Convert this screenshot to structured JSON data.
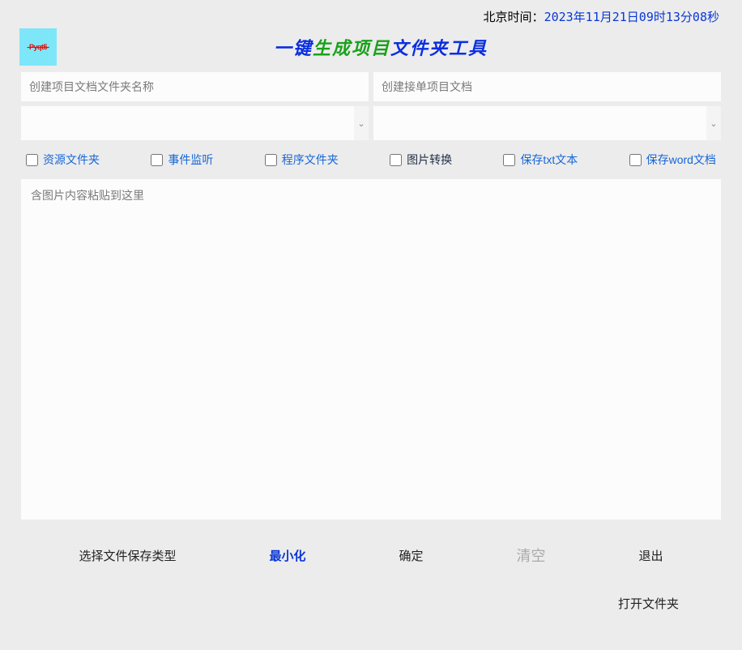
{
  "header": {
    "time_label": "北京时间：",
    "time_value": "2023年11月21日09时13分08秒",
    "logo_text": "-Pyqt5-",
    "title_p1": "一键",
    "title_p2": "生成项目",
    "title_p3": "文件夹工具"
  },
  "inputs": {
    "project_doc_placeholder": "创建项目文档文件夹名称",
    "order_doc_placeholder": "创建接单项目文档"
  },
  "checks": {
    "resource": "资源文件夹",
    "event": "事件监听",
    "program": "程序文件夹",
    "image": "图片转换",
    "save_txt": "保存txt文本",
    "save_word": "保存word文档"
  },
  "textarea": {
    "placeholder": "含图片内容粘贴到这里"
  },
  "buttons": {
    "choose_type": "选择文件保存类型",
    "minimize": "最小化",
    "confirm": "确定",
    "clear": "清空",
    "exit": "退出",
    "open_folder": "打开文件夹"
  },
  "icons": {
    "chevron_down": "⌄"
  }
}
